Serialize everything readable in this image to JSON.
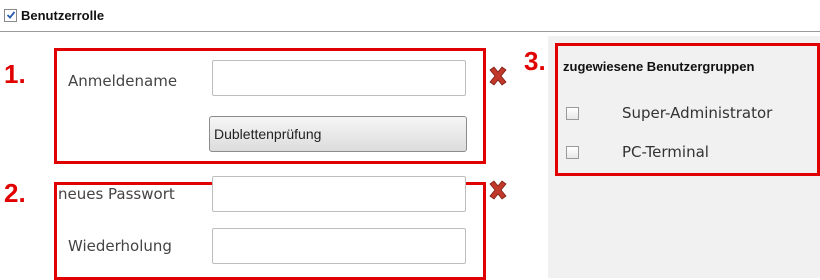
{
  "section": {
    "title": "Benutzerrolle",
    "checked": true
  },
  "annotations": {
    "one": "1.",
    "two": "2.",
    "three": "3."
  },
  "login": {
    "label": "Anmeldename",
    "value": "",
    "duplicate_check_button": "Dublettenprüfung"
  },
  "password": {
    "new_label": "neues Passwort",
    "new_value": "",
    "repeat_label": "Wiederholung",
    "repeat_value": ""
  },
  "groups": {
    "title": "zugewiesene Benutzergruppen",
    "items": [
      {
        "label": "Super-Administrator",
        "checked": false
      },
      {
        "label": "PC-Terminal",
        "checked": false
      }
    ]
  },
  "colors": {
    "annotation_red": "#e00000",
    "delete_icon": "#c0392b"
  },
  "icons": {
    "section_checkbox": "checkbox-checked-icon",
    "clear": "red-x-icon"
  }
}
